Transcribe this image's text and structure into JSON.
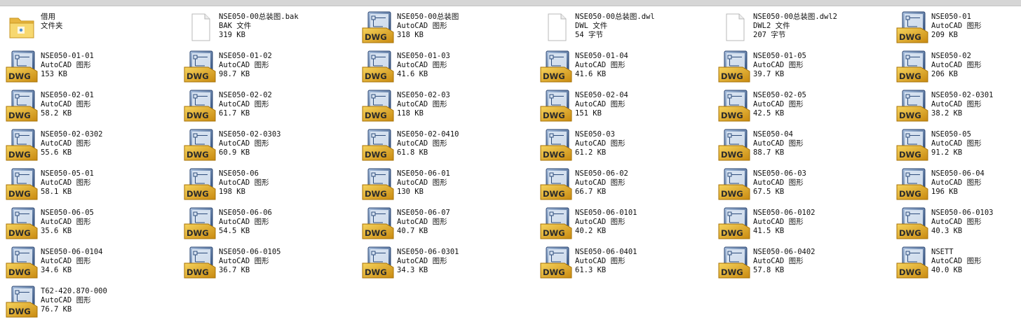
{
  "items": [
    {
      "name": "借用",
      "type": "文件夹",
      "size": "",
      "icon": "folder-icon"
    },
    {
      "name": "NSE050-00总装图.bak",
      "type": "BAK 文件",
      "size": "319 KB",
      "icon": "blank-file-icon"
    },
    {
      "name": "NSE050-00总装图",
      "type": "AutoCAD 图形",
      "size": "318 KB",
      "icon": "dwg-file-icon"
    },
    {
      "name": "NSE050-00总装图.dwl",
      "type": "DWL 文件",
      "size": "54 字节",
      "icon": "blank-file-icon"
    },
    {
      "name": "NSE050-00总装图.dwl2",
      "type": "DWL2 文件",
      "size": "207 字节",
      "icon": "blank-file-icon"
    },
    {
      "name": "NSE050-01",
      "type": "AutoCAD 图形",
      "size": "209 KB",
      "icon": "dwg-file-icon"
    },
    {
      "name": "NSE050-01-01",
      "type": "AutoCAD 图形",
      "size": "153 KB",
      "icon": "dwg-file-icon"
    },
    {
      "name": "NSE050-01-02",
      "type": "AutoCAD 图形",
      "size": "98.7 KB",
      "icon": "dwg-file-icon"
    },
    {
      "name": "NSE050-01-03",
      "type": "AutoCAD 图形",
      "size": "41.6 KB",
      "icon": "dwg-file-icon"
    },
    {
      "name": "NSE050-01-04",
      "type": "AutoCAD 图形",
      "size": "41.6 KB",
      "icon": "dwg-file-icon"
    },
    {
      "name": "NSE050-01-05",
      "type": "AutoCAD 图形",
      "size": "39.7 KB",
      "icon": "dwg-file-icon"
    },
    {
      "name": "NSE050-02",
      "type": "AutoCAD 图形",
      "size": "206 KB",
      "icon": "dwg-file-icon"
    },
    {
      "name": "NSE050-02-01",
      "type": "AutoCAD 图形",
      "size": "58.2 KB",
      "icon": "dwg-file-icon"
    },
    {
      "name": "NSE050-02-02",
      "type": "AutoCAD 图形",
      "size": "61.7 KB",
      "icon": "dwg-file-icon"
    },
    {
      "name": "NSE050-02-03",
      "type": "AutoCAD 图形",
      "size": "118 KB",
      "icon": "dwg-file-icon"
    },
    {
      "name": "NSE050-02-04",
      "type": "AutoCAD 图形",
      "size": "151 KB",
      "icon": "dwg-file-icon"
    },
    {
      "name": "NSE050-02-05",
      "type": "AutoCAD 图形",
      "size": "42.5 KB",
      "icon": "dwg-file-icon"
    },
    {
      "name": "NSE050-02-0301",
      "type": "AutoCAD 图形",
      "size": "38.2 KB",
      "icon": "dwg-file-icon"
    },
    {
      "name": "NSE050-02-0302",
      "type": "AutoCAD 图形",
      "size": "55.6 KB",
      "icon": "dwg-file-icon"
    },
    {
      "name": "NSE050-02-0303",
      "type": "AutoCAD 图形",
      "size": "60.9 KB",
      "icon": "dwg-file-icon"
    },
    {
      "name": "NSE050-02-0410",
      "type": "AutoCAD 图形",
      "size": "61.8 KB",
      "icon": "dwg-file-icon"
    },
    {
      "name": "NSE050-03",
      "type": "AutoCAD 图形",
      "size": "61.2 KB",
      "icon": "dwg-file-icon"
    },
    {
      "name": "NSE050-04",
      "type": "AutoCAD 图形",
      "size": "88.7 KB",
      "icon": "dwg-file-icon"
    },
    {
      "name": "NSE050-05",
      "type": "AutoCAD 图形",
      "size": "91.2 KB",
      "icon": "dwg-file-icon"
    },
    {
      "name": "NSE050-05-01",
      "type": "AutoCAD 图形",
      "size": "58.1 KB",
      "icon": "dwg-file-icon"
    },
    {
      "name": "NSE050-06",
      "type": "AutoCAD 图形",
      "size": "198 KB",
      "icon": "dwg-file-icon"
    },
    {
      "name": "NSE050-06-01",
      "type": "AutoCAD 图形",
      "size": "130 KB",
      "icon": "dwg-file-icon"
    },
    {
      "name": "NSE050-06-02",
      "type": "AutoCAD 图形",
      "size": "66.7 KB",
      "icon": "dwg-file-icon"
    },
    {
      "name": "NSE050-06-03",
      "type": "AutoCAD 图形",
      "size": "67.5 KB",
      "icon": "dwg-file-icon"
    },
    {
      "name": "NSE050-06-04",
      "type": "AutoCAD 图形",
      "size": "196 KB",
      "icon": "dwg-file-icon"
    },
    {
      "name": "NSE050-06-05",
      "type": "AutoCAD 图形",
      "size": "35.6 KB",
      "icon": "dwg-file-icon"
    },
    {
      "name": "NSE050-06-06",
      "type": "AutoCAD 图形",
      "size": "54.5 KB",
      "icon": "dwg-file-icon"
    },
    {
      "name": "NSE050-06-07",
      "type": "AutoCAD 图形",
      "size": "40.7 KB",
      "icon": "dwg-file-icon"
    },
    {
      "name": "NSE050-06-0101",
      "type": "AutoCAD 图形",
      "size": "40.2 KB",
      "icon": "dwg-file-icon"
    },
    {
      "name": "NSE050-06-0102",
      "type": "AutoCAD 图形",
      "size": "41.5 KB",
      "icon": "dwg-file-icon"
    },
    {
      "name": "NSE050-06-0103",
      "type": "AutoCAD 图形",
      "size": "40.3 KB",
      "icon": "dwg-file-icon"
    },
    {
      "name": "NSE050-06-0104",
      "type": "AutoCAD 图形",
      "size": "34.6 KB",
      "icon": "dwg-file-icon"
    },
    {
      "name": "NSE050-06-0105",
      "type": "AutoCAD 图形",
      "size": "36.7 KB",
      "icon": "dwg-file-icon"
    },
    {
      "name": "NSE050-06-0301",
      "type": "AutoCAD 图形",
      "size": "34.3 KB",
      "icon": "dwg-file-icon"
    },
    {
      "name": "NSE050-06-0401",
      "type": "AutoCAD 图形",
      "size": "61.3 KB",
      "icon": "dwg-file-icon"
    },
    {
      "name": "NSE050-06-0402",
      "type": "AutoCAD 图形",
      "size": "57.8 KB",
      "icon": "dwg-file-icon"
    },
    {
      "name": "NSETT",
      "type": "AutoCAD 图形",
      "size": "40.0 KB",
      "icon": "dwg-file-icon"
    },
    {
      "name": "T62-420.870-000",
      "type": "AutoCAD 图形",
      "size": "76.7 KB",
      "icon": "dwg-file-icon"
    }
  ],
  "dwg_badge": "DWG",
  "colors": {
    "dwg_gold": "#e3a51c",
    "dwg_blue": "#3f5f8f",
    "folder": "#f2cf63"
  }
}
